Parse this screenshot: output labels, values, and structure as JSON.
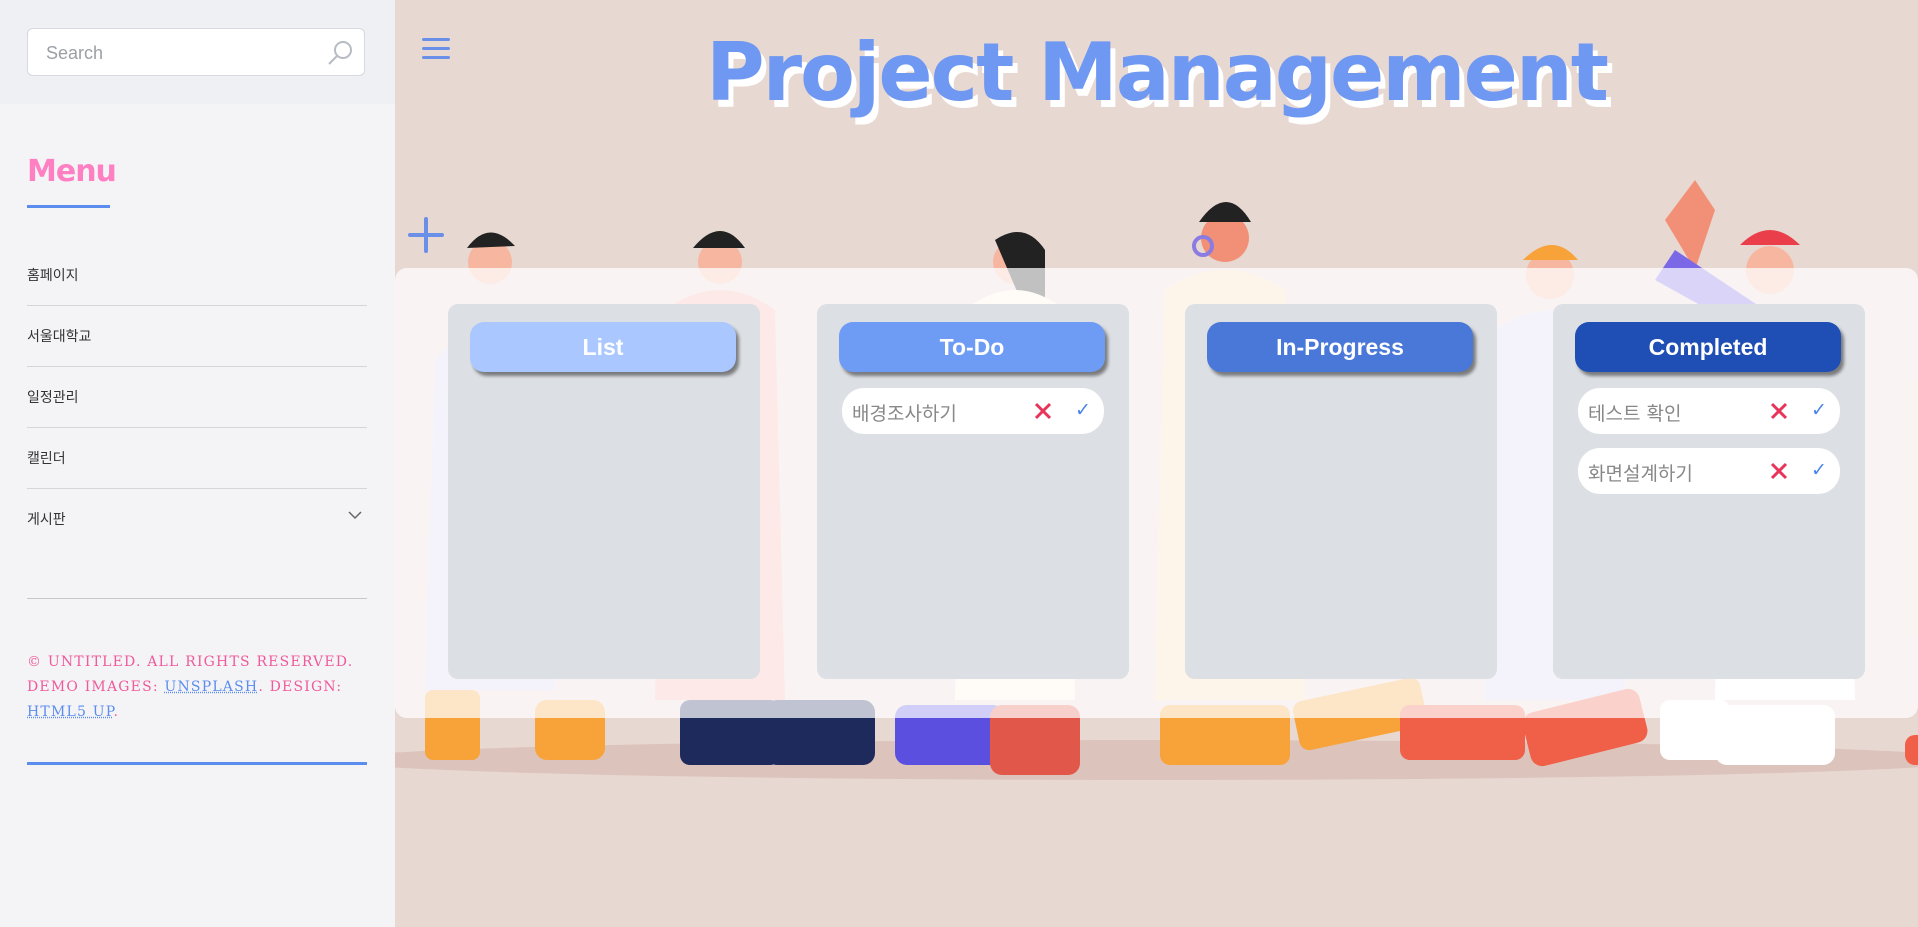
{
  "sidebar": {
    "search": {
      "placeholder": "Search"
    },
    "menu_title": "Menu",
    "items": [
      {
        "label": "홈페이지"
      },
      {
        "label": "서울대학교"
      },
      {
        "label": "일정관리"
      },
      {
        "label": "캘린더"
      },
      {
        "label": "게시판"
      }
    ],
    "footer": {
      "line1": "© UNTITLED. ALL RIGHTS RESERVED.",
      "demo_prefix": "DEMO IMAGES: ",
      "unsplash": "UNSPLASH",
      "design_prefix": ". DESIGN:",
      "html5up": "HTML5 UP",
      "end": "."
    }
  },
  "main": {
    "title": "Project Management",
    "columns": [
      {
        "title": "List",
        "color": "#aac8ff",
        "tasks": []
      },
      {
        "title": "To-Do",
        "color": "#6e9cf4",
        "tasks": [
          {
            "text": "배경조사하기"
          }
        ]
      },
      {
        "title": "In-Progress",
        "color": "#4a78d8",
        "tasks": []
      },
      {
        "title": "Completed",
        "color": "#1f4fb4",
        "tasks": [
          {
            "text": "테스트 확인"
          },
          {
            "text": "화면설계하기"
          }
        ]
      }
    ],
    "delete_icon": "x-icon",
    "complete_icon": "check-icon",
    "check_glyph": "✓"
  }
}
